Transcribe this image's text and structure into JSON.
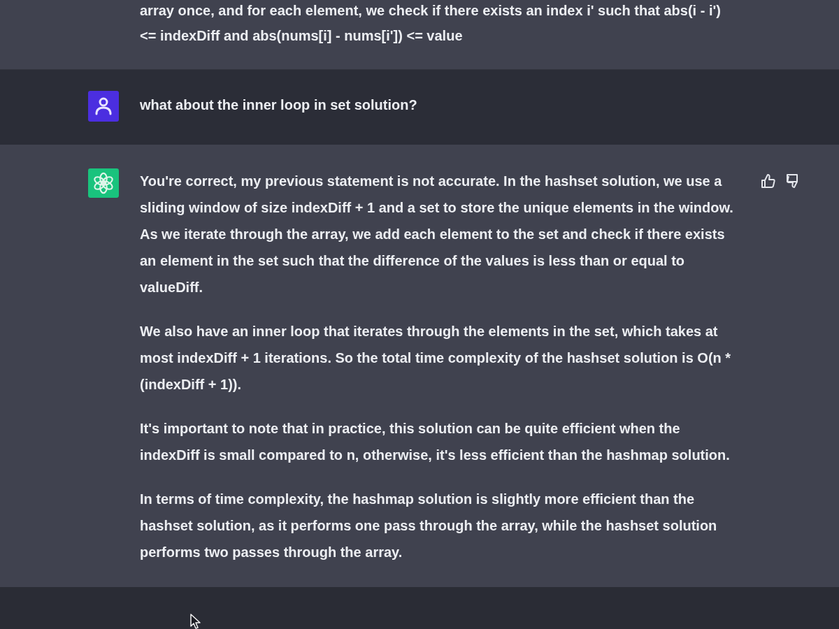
{
  "previous_reply_tail": {
    "lines": [
      "array once, and for each element, we check if there exists an index i' such that abs(i - i')",
      "<= indexDiff and abs(nums[i] - nums[i']) <= value"
    ]
  },
  "messages": [
    {
      "kind": "user",
      "paragraphs": [
        "what about the inner loop in set solution?"
      ]
    },
    {
      "kind": "assistant",
      "paragraphs": [
        "You're correct, my previous statement is not accurate. In the hashset solution, we use a sliding window of size indexDiff + 1 and a set to store the unique elements in the window. As we iterate through the array, we add each element to the set and check if there exists an element in the set such that the difference of the values is less than or equal to valueDiff.",
        "We also have an inner loop that iterates through the elements in the set, which takes at most indexDiff + 1 iterations. So the total time complexity of the hashset solution is O(n * (indexDiff + 1)).",
        "It's important to note that in practice, this solution can be quite efficient when the indexDiff is small compared to n, otherwise, it's less efficient than the hashmap solution.",
        "In terms of time complexity, the hashmap solution is slightly more efficient than the hashset solution, as it performs one pass through the array, while the hashset solution performs two passes through the array."
      ]
    }
  ]
}
